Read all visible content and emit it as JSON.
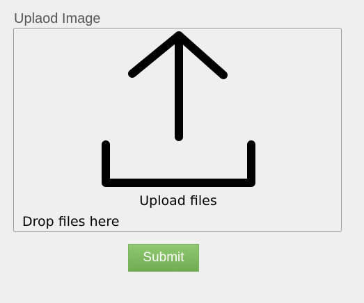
{
  "form": {
    "field_label": "Uplaod Image",
    "dropzone": {
      "icon": "upload-icon",
      "upload_label": "Upload files",
      "drop_label": "Drop files here"
    },
    "submit_label": "Submit"
  },
  "colors": {
    "background": "#efefef",
    "button": "#7cbb5f",
    "label_text": "#555555"
  }
}
